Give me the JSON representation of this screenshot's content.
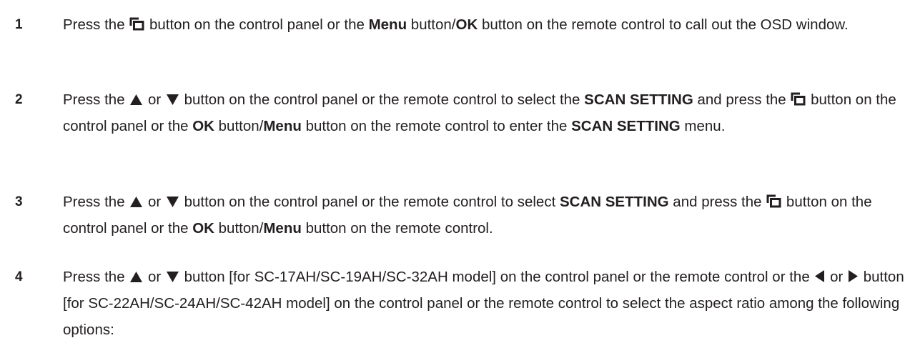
{
  "steps": [
    {
      "number": "1",
      "parts": [
        {
          "t": "Press the "
        },
        {
          "icon": "menu-icon"
        },
        {
          "t": " button on the control panel or the "
        },
        {
          "b": "Menu"
        },
        {
          "t": " button/"
        },
        {
          "b": "OK"
        },
        {
          "t": " button on the remote control to call out the OSD window."
        }
      ]
    },
    {
      "number": "2",
      "parts": [
        {
          "t": "Press the "
        },
        {
          "icon": "up-arrow-icon"
        },
        {
          "t": " or "
        },
        {
          "icon": "down-arrow-icon"
        },
        {
          "t": " button on the control panel or the remote control to select the "
        },
        {
          "b": "SCAN SETTING"
        },
        {
          "t": " and press the "
        },
        {
          "icon": "menu-icon"
        },
        {
          "t": " button on the control panel or the "
        },
        {
          "b": "OK"
        },
        {
          "t": " button/"
        },
        {
          "b": "Menu"
        },
        {
          "t": " button on the remote control to enter the "
        },
        {
          "b": "SCAN SETTING"
        },
        {
          "t": " menu."
        }
      ]
    },
    {
      "number": "3",
      "parts": [
        {
          "t": "Press the "
        },
        {
          "icon": "up-arrow-icon"
        },
        {
          "t": " or "
        },
        {
          "icon": "down-arrow-icon"
        },
        {
          "t": " button on the control panel or the remote control to select "
        },
        {
          "b": "SCAN SETTING"
        },
        {
          "t": " and press the "
        },
        {
          "icon": "menu-icon"
        },
        {
          "t": " button on the control panel or the "
        },
        {
          "b": "OK"
        },
        {
          "t": " button/"
        },
        {
          "b": "Menu"
        },
        {
          "t": " button on the remote control."
        }
      ]
    },
    {
      "number": "4",
      "parts": [
        {
          "t": "Press the "
        },
        {
          "icon": "up-arrow-icon"
        },
        {
          "t": " or "
        },
        {
          "icon": "down-arrow-icon"
        },
        {
          "t": " button [for SC-17AH/SC-19AH/SC-32AH model] on the control panel or the remote control or the "
        },
        {
          "icon": "left-arrow-icon"
        },
        {
          "t": " or "
        },
        {
          "icon": "right-arrow-icon"
        },
        {
          "t": " button [for SC-22AH/SC-24AH/SC-42AH model] on the control panel or the remote control to select the aspect ratio among the following options:"
        }
      ]
    }
  ],
  "text_color": "#231f20"
}
